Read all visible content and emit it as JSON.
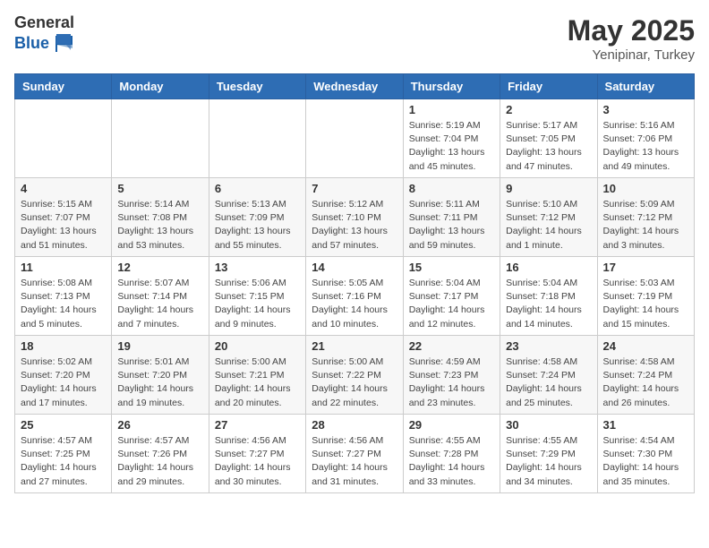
{
  "header": {
    "logo_general": "General",
    "logo_blue": "Blue",
    "title": "May 2025",
    "location": "Yenipinar, Turkey"
  },
  "weekdays": [
    "Sunday",
    "Monday",
    "Tuesday",
    "Wednesday",
    "Thursday",
    "Friday",
    "Saturday"
  ],
  "weeks": [
    [
      {
        "day": "",
        "info": ""
      },
      {
        "day": "",
        "info": ""
      },
      {
        "day": "",
        "info": ""
      },
      {
        "day": "",
        "info": ""
      },
      {
        "day": "1",
        "info": "Sunrise: 5:19 AM\nSunset: 7:04 PM\nDaylight: 13 hours\nand 45 minutes."
      },
      {
        "day": "2",
        "info": "Sunrise: 5:17 AM\nSunset: 7:05 PM\nDaylight: 13 hours\nand 47 minutes."
      },
      {
        "day": "3",
        "info": "Sunrise: 5:16 AM\nSunset: 7:06 PM\nDaylight: 13 hours\nand 49 minutes."
      }
    ],
    [
      {
        "day": "4",
        "info": "Sunrise: 5:15 AM\nSunset: 7:07 PM\nDaylight: 13 hours\nand 51 minutes."
      },
      {
        "day": "5",
        "info": "Sunrise: 5:14 AM\nSunset: 7:08 PM\nDaylight: 13 hours\nand 53 minutes."
      },
      {
        "day": "6",
        "info": "Sunrise: 5:13 AM\nSunset: 7:09 PM\nDaylight: 13 hours\nand 55 minutes."
      },
      {
        "day": "7",
        "info": "Sunrise: 5:12 AM\nSunset: 7:10 PM\nDaylight: 13 hours\nand 57 minutes."
      },
      {
        "day": "8",
        "info": "Sunrise: 5:11 AM\nSunset: 7:11 PM\nDaylight: 13 hours\nand 59 minutes."
      },
      {
        "day": "9",
        "info": "Sunrise: 5:10 AM\nSunset: 7:12 PM\nDaylight: 14 hours\nand 1 minute."
      },
      {
        "day": "10",
        "info": "Sunrise: 5:09 AM\nSunset: 7:12 PM\nDaylight: 14 hours\nand 3 minutes."
      }
    ],
    [
      {
        "day": "11",
        "info": "Sunrise: 5:08 AM\nSunset: 7:13 PM\nDaylight: 14 hours\nand 5 minutes."
      },
      {
        "day": "12",
        "info": "Sunrise: 5:07 AM\nSunset: 7:14 PM\nDaylight: 14 hours\nand 7 minutes."
      },
      {
        "day": "13",
        "info": "Sunrise: 5:06 AM\nSunset: 7:15 PM\nDaylight: 14 hours\nand 9 minutes."
      },
      {
        "day": "14",
        "info": "Sunrise: 5:05 AM\nSunset: 7:16 PM\nDaylight: 14 hours\nand 10 minutes."
      },
      {
        "day": "15",
        "info": "Sunrise: 5:04 AM\nSunset: 7:17 PM\nDaylight: 14 hours\nand 12 minutes."
      },
      {
        "day": "16",
        "info": "Sunrise: 5:04 AM\nSunset: 7:18 PM\nDaylight: 14 hours\nand 14 minutes."
      },
      {
        "day": "17",
        "info": "Sunrise: 5:03 AM\nSunset: 7:19 PM\nDaylight: 14 hours\nand 15 minutes."
      }
    ],
    [
      {
        "day": "18",
        "info": "Sunrise: 5:02 AM\nSunset: 7:20 PM\nDaylight: 14 hours\nand 17 minutes."
      },
      {
        "day": "19",
        "info": "Sunrise: 5:01 AM\nSunset: 7:20 PM\nDaylight: 14 hours\nand 19 minutes."
      },
      {
        "day": "20",
        "info": "Sunrise: 5:00 AM\nSunset: 7:21 PM\nDaylight: 14 hours\nand 20 minutes."
      },
      {
        "day": "21",
        "info": "Sunrise: 5:00 AM\nSunset: 7:22 PM\nDaylight: 14 hours\nand 22 minutes."
      },
      {
        "day": "22",
        "info": "Sunrise: 4:59 AM\nSunset: 7:23 PM\nDaylight: 14 hours\nand 23 minutes."
      },
      {
        "day": "23",
        "info": "Sunrise: 4:58 AM\nSunset: 7:24 PM\nDaylight: 14 hours\nand 25 minutes."
      },
      {
        "day": "24",
        "info": "Sunrise: 4:58 AM\nSunset: 7:24 PM\nDaylight: 14 hours\nand 26 minutes."
      }
    ],
    [
      {
        "day": "25",
        "info": "Sunrise: 4:57 AM\nSunset: 7:25 PM\nDaylight: 14 hours\nand 27 minutes."
      },
      {
        "day": "26",
        "info": "Sunrise: 4:57 AM\nSunset: 7:26 PM\nDaylight: 14 hours\nand 29 minutes."
      },
      {
        "day": "27",
        "info": "Sunrise: 4:56 AM\nSunset: 7:27 PM\nDaylight: 14 hours\nand 30 minutes."
      },
      {
        "day": "28",
        "info": "Sunrise: 4:56 AM\nSunset: 7:27 PM\nDaylight: 14 hours\nand 31 minutes."
      },
      {
        "day": "29",
        "info": "Sunrise: 4:55 AM\nSunset: 7:28 PM\nDaylight: 14 hours\nand 33 minutes."
      },
      {
        "day": "30",
        "info": "Sunrise: 4:55 AM\nSunset: 7:29 PM\nDaylight: 14 hours\nand 34 minutes."
      },
      {
        "day": "31",
        "info": "Sunrise: 4:54 AM\nSunset: 7:30 PM\nDaylight: 14 hours\nand 35 minutes."
      }
    ]
  ]
}
